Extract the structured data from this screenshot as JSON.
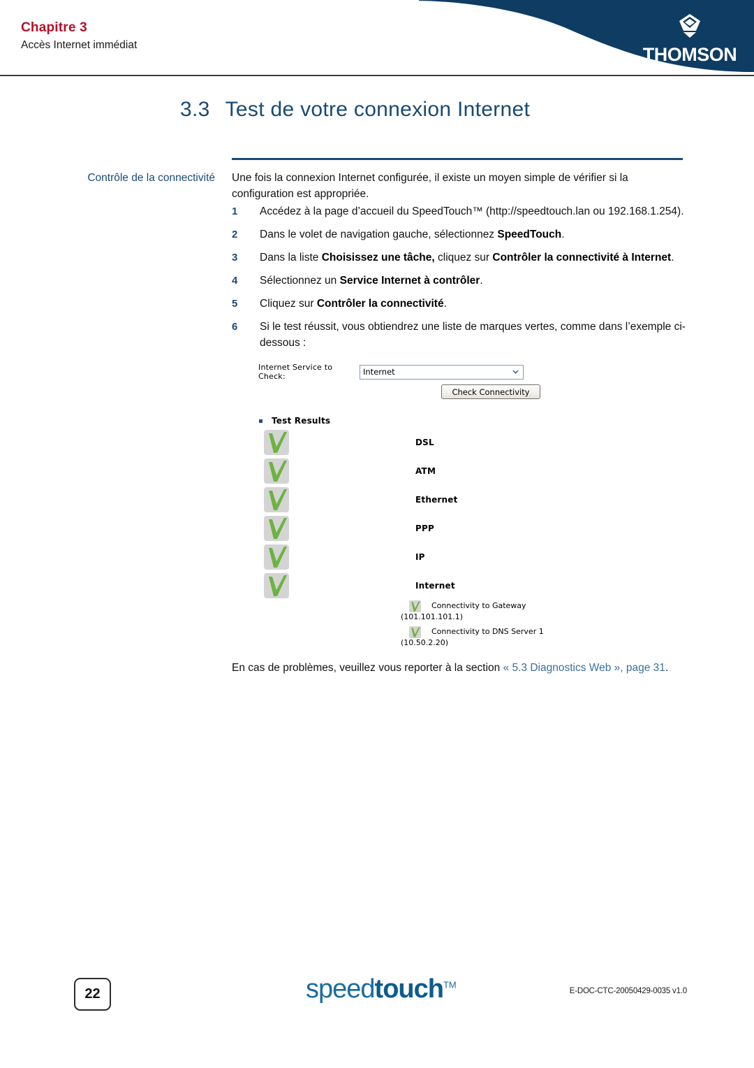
{
  "header": {
    "chapter_label": "Chapitre 3",
    "chapter_subtitle": "Accès Internet immédiat",
    "brand": "THOMSON"
  },
  "section": {
    "number": "3.3",
    "title": "Test de votre connexion Internet"
  },
  "margin_label": "Contrôle de la connectivité",
  "intro_paragraph": "Une fois la connexion Internet configurée, il existe un moyen simple de vérifier si la configuration est appropriée.",
  "steps": [
    {
      "num": "1",
      "html": "Accédez à la page d’accueil du SpeedTouch™ (http://speedtouch.lan ou 192.168.1.254)."
    },
    {
      "num": "2",
      "html": "Dans le volet de navigation gauche, sélectionnez <b>SpeedTouch</b>."
    },
    {
      "num": "3",
      "html": "Dans la liste <b>Choisissez une tâche,</b> cliquez sur  <b>Contrôler la connectivité à Internet</b>."
    },
    {
      "num": "4",
      "html": "Sélectionnez un <b>Service Internet à contrôler</b>."
    },
    {
      "num": "5",
      "html": "Cliquez sur <b>Contrôler la connectivité</b>."
    },
    {
      "num": "6",
      "html": "Si le test réussit, vous obtiendrez une liste de marques vertes, comme dans l’exemple ci-dessous :"
    }
  ],
  "embedded_ui": {
    "service_label": "Internet Service to Check:",
    "service_selected": "Internet",
    "check_button": "Check Connectivity",
    "test_results_title": "Test Results",
    "results": [
      {
        "label": "DSL",
        "status": "ok"
      },
      {
        "label": "ATM",
        "status": "ok"
      },
      {
        "label": "Ethernet",
        "status": "ok"
      },
      {
        "label": "PPP",
        "status": "ok"
      },
      {
        "label": "IP",
        "status": "ok"
      },
      {
        "label": "Internet",
        "status": "ok"
      }
    ],
    "sub_results": [
      {
        "label": "Connectivity to Gateway",
        "address": "(101.101.101.1)",
        "status": "ok"
      },
      {
        "label": "Connectivity to DNS Server 1",
        "address": "(10.50.2.20)",
        "status": "ok"
      }
    ]
  },
  "closing_paragraph": {
    "before": "En cas de problèmes, veuillez vous reporter à la section ",
    "link": "« 5.3 Diagnostics Web », page 31",
    "after": "."
  },
  "footer": {
    "page_number": "22",
    "logo_light": "speed",
    "logo_bold": "touch",
    "logo_tm": "TM",
    "doc_id": "E-DOC-CTC-20050429-0035 v1.0"
  },
  "colors": {
    "banner_navy": "#0f3c63",
    "chapter_red": "#b5112b",
    "title_blue": "#1a4a73",
    "rule_blue": "#1c4b78",
    "link_blue": "#3a6f9f",
    "check_green": "#6cb33f",
    "check_bg": "#d4d4d4"
  }
}
